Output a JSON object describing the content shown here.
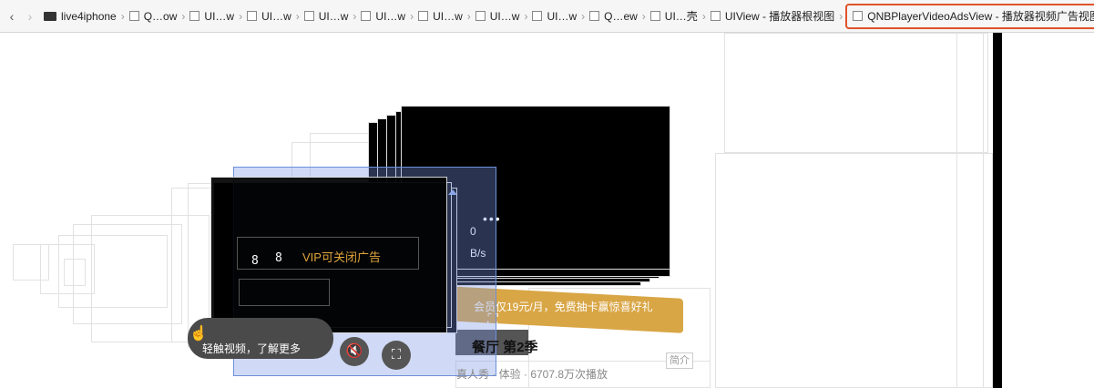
{
  "toolbar": {
    "back_icon": "chevron-left-icon",
    "forward_icon": "chevron-right-icon"
  },
  "breadcrumb": [
    {
      "label": "live4iphone",
      "icon": "device-icon"
    },
    {
      "label": "Q…ow"
    },
    {
      "label": "UI…w"
    },
    {
      "label": "UI…w"
    },
    {
      "label": "UI…w"
    },
    {
      "label": "UI…w"
    },
    {
      "label": "UI…w"
    },
    {
      "label": "UI…w"
    },
    {
      "label": "UI…w"
    },
    {
      "label": "Q…ew"
    },
    {
      "label": "UI…壳"
    },
    {
      "label": "UIView - 播放器根视图"
    },
    {
      "label": "QNBPlayerVideoAdsView - 播放器视频广告视图",
      "selected": true
    }
  ],
  "canvas": {
    "vip_ad_text": "VIP可关闭广告",
    "countdown_a": "8",
    "countdown_b": "8",
    "touch_label": "轻触视频，了解更多",
    "banner_text": "会员仅19元/月，免费抽卡赢惊喜好礼",
    "season_text": "餐厅 第2季",
    "meta_text": "真人秀 · 体验 · 6707.8万次播放",
    "intro_label": "简介",
    "speed_text": "B/s",
    "zero_text": "0",
    "dots": "•••",
    "mute_icon": "mute-icon",
    "fullscreen_icon": "fullscreen-icon",
    "touch_icon": "touch-icon"
  },
  "colors": {
    "selection_border": "#e0522b",
    "banner": "#d9a646",
    "vip_text": "#e2a53b"
  }
}
